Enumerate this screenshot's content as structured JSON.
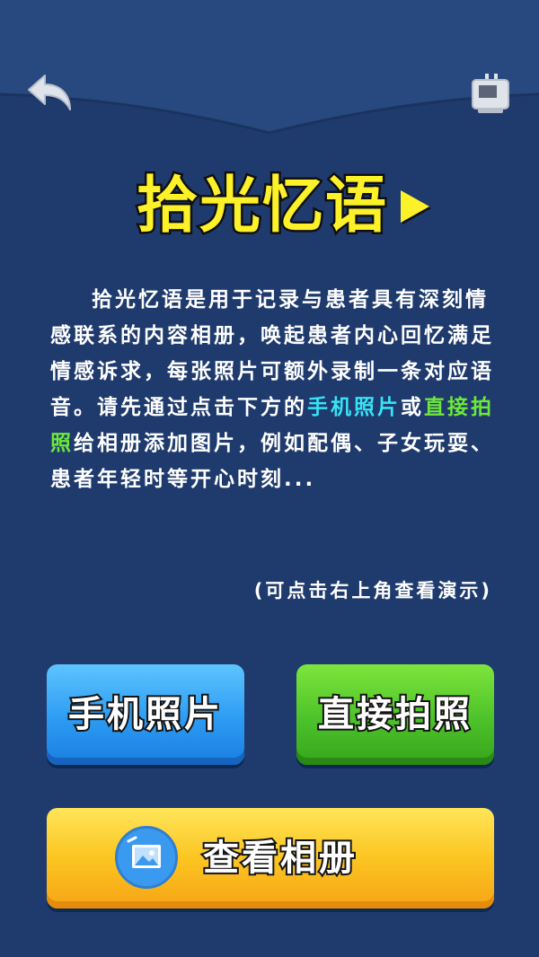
{
  "screen": {
    "title": "拾光忆语",
    "description": {
      "part1": "拾光忆语是用于记录与患者具有深刻情感联系的内容相册，唤起患者内心回忆满足情感诉求，每张照片可额外录制一条对应语音。请先通过点击下方的",
      "link_phone": "手机照片",
      "connector": "或",
      "link_camera": "直接拍照",
      "part2": "给相册添加图片，例如配偶、子女玩耍、患者年轻时等开心时刻..."
    },
    "hint": "(可点击右上角查看演示)"
  },
  "buttons": {
    "phone_photos": "手机照片",
    "take_photo": "直接拍照",
    "view_album": "查看相册"
  },
  "icons": {
    "back": "back-arrow-icon",
    "demo": "demo-tv-icon",
    "play": "play-triangle-icon",
    "album": "image-icon"
  },
  "colors": {
    "background": "#1f3b6e",
    "title": "#fdf22a",
    "highlight_phone": "#38e3f5",
    "highlight_camera": "#6ee83a",
    "btn_blue": "#2c9bf3",
    "btn_green": "#4cc22a",
    "btn_yellow": "#fbc521"
  }
}
